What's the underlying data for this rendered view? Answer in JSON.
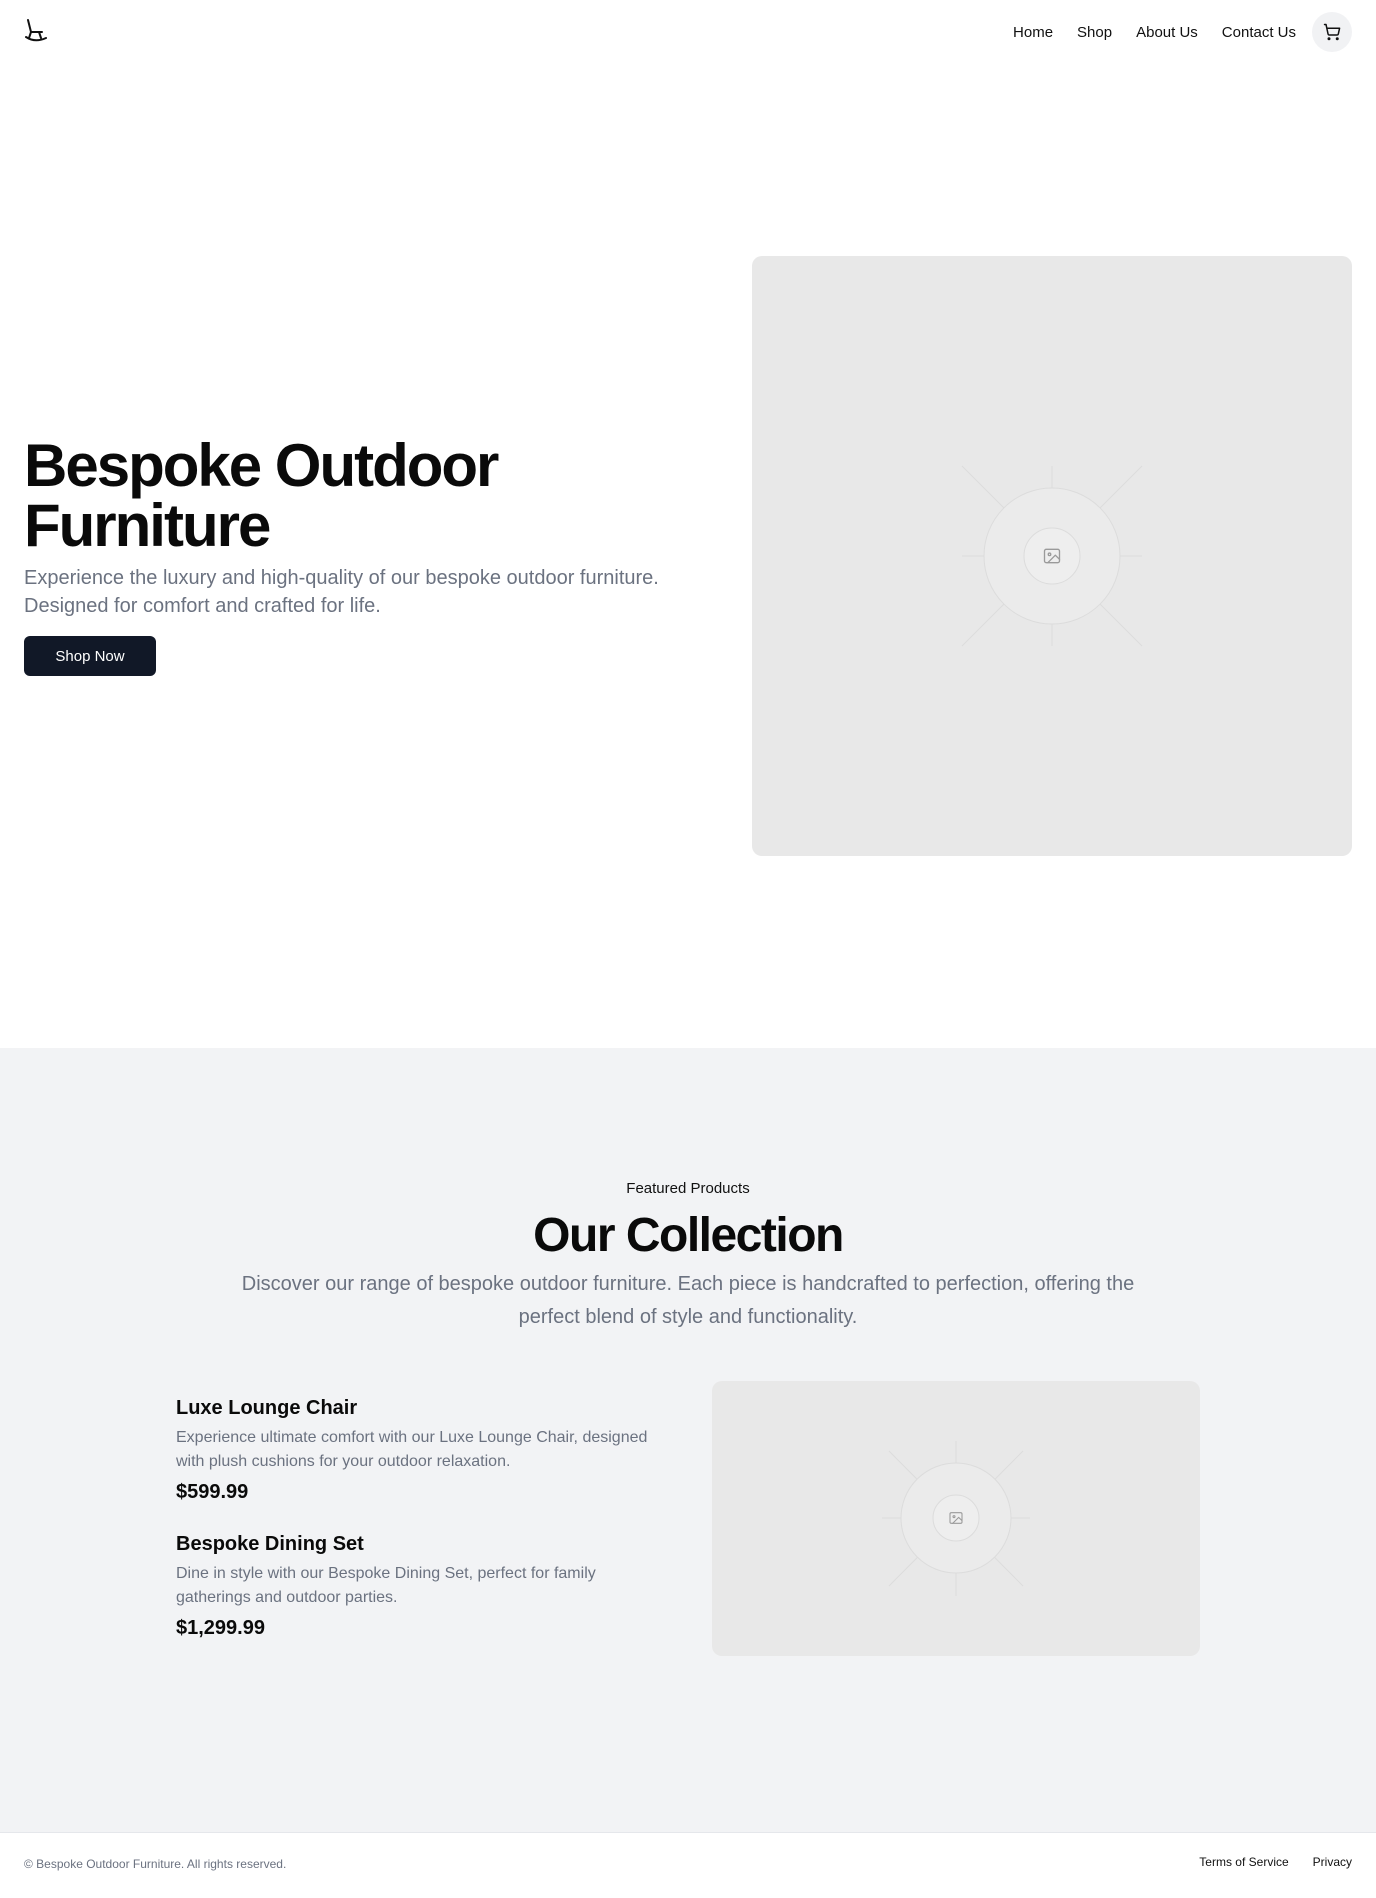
{
  "header": {
    "logo_icon": "rocking-chair-icon",
    "nav": {
      "home": "Home",
      "shop": "Shop",
      "about": "About Us",
      "contact": "Contact Us"
    },
    "cart_icon": "shopping-cart-icon"
  },
  "hero": {
    "title": "Bespoke Outdoor Furniture",
    "subtitle": "Experience the luxury and high-quality of our bespoke outdoor furniture. Designed for comfort and crafted for life.",
    "cta": "Shop Now",
    "image_icon": "image-placeholder-icon"
  },
  "collection": {
    "eyebrow": "Featured Products",
    "title": "Our Collection",
    "subtitle": "Discover our range of bespoke outdoor furniture. Each piece is handcrafted to perfection, offering the perfect blend of style and functionality.",
    "products": [
      {
        "name": "Luxe Lounge Chair",
        "description": "Experience ultimate comfort with our Luxe Lounge Chair, designed with plush cushions for your outdoor relaxation.",
        "price": "$599.99"
      },
      {
        "name": "Bespoke Dining Set",
        "description": "Dine in style with our Bespoke Dining Set, perfect for family gatherings and outdoor parties.",
        "price": "$1,299.99"
      }
    ],
    "image_icon": "image-placeholder-icon"
  },
  "footer": {
    "copyright": "© Bespoke Outdoor Furniture. All rights reserved.",
    "terms": "Terms of Service",
    "privacy": "Privacy"
  },
  "colors": {
    "primary_button": "#111827",
    "muted_text": "#6b7280",
    "section_bg": "#f2f3f5",
    "placeholder_bg": "#e8e8e8"
  }
}
